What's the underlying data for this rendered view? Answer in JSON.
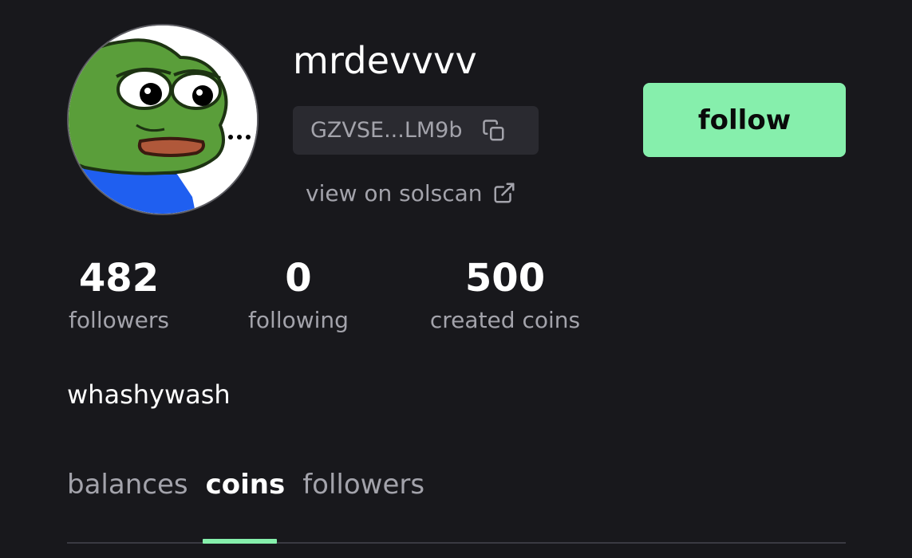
{
  "profile": {
    "username": "mrdevvvv",
    "address_short": "GZVSE...LM9b",
    "solscan_label": "view on solscan",
    "follow_label": "follow",
    "bio": "whashywash"
  },
  "stats": {
    "followers": {
      "value": "482",
      "label": "followers"
    },
    "following": {
      "value": "0",
      "label": "following"
    },
    "created": {
      "value": "500",
      "label": "created coins"
    }
  },
  "tabs": [
    {
      "label": "balances",
      "active": false
    },
    {
      "label": "coins",
      "active": true
    },
    {
      "label": "followers",
      "active": false
    }
  ],
  "colors": {
    "background": "#18181c",
    "accent": "#86efac",
    "chip": "#2a2a30",
    "muted_text": "#a3a3ab"
  },
  "icons": {
    "copy": "copy-icon",
    "external": "external-link-icon"
  }
}
